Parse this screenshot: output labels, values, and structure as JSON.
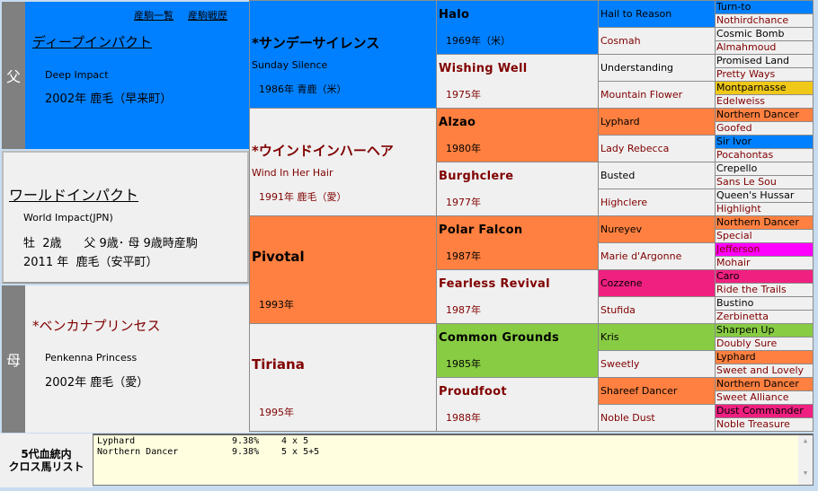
{
  "colors": {
    "blue": "#0080ff",
    "orange": "#ff8040",
    "pink": "#f02080",
    "magenta": "#ff00ff",
    "green": "#88cc44",
    "yellow": "#f0c818",
    "gray": "#f0f0f0"
  },
  "sire": {
    "strip": "父",
    "links": [
      "産駒一覧",
      "産駒戦歴"
    ],
    "name": "ディープインパクト",
    "en": "Deep Impact",
    "info": "2002年  鹿毛（早来町）"
  },
  "subject": {
    "name": "ワールドインパクト",
    "en": "World Impact(JPN)",
    "line1": "牡  2歳      父 9歳･ 母 9歳時産駒",
    "line2": "2011 年  鹿毛（安平町）"
  },
  "dam": {
    "strip": "母",
    "name": "*ベンカナプリンセス",
    "en": "Penkenna Princess",
    "info": "2002年  鹿毛（愛）"
  },
  "gen2": [
    {
      "name": "*サンデーサイレンス",
      "en": "Sunday Silence",
      "year": "1986年  青鹿（米）",
      "sex": "m",
      "bg": "blue"
    },
    {
      "name": "*ウインドインハーヘア",
      "en": "Wind In Her Hair",
      "year": "1991年  鹿毛（愛）",
      "sex": "f",
      "bg": "gray"
    },
    {
      "name": "Pivotal",
      "en": "",
      "year": "1993年",
      "sex": "m",
      "bg": "orange"
    },
    {
      "name": "Tiriana",
      "en": "",
      "year": "1995年",
      "sex": "f",
      "bg": "gray"
    }
  ],
  "gen3": [
    {
      "name": "Halo",
      "year": "1969年（米）",
      "sex": "m",
      "bg": "blue"
    },
    {
      "name": "Wishing Well",
      "year": "1975年",
      "sex": "f",
      "bg": "gray"
    },
    {
      "name": "Alzao",
      "year": "1980年",
      "sex": "m",
      "bg": "orange"
    },
    {
      "name": "Burghclere",
      "year": "1977年",
      "sex": "f",
      "bg": "gray"
    },
    {
      "name": "Polar Falcon",
      "year": "1987年",
      "sex": "m",
      "bg": "orange"
    },
    {
      "name": "Fearless Revival",
      "year": "1987年",
      "sex": "f",
      "bg": "gray"
    },
    {
      "name": "Common Grounds",
      "year": "1985年",
      "sex": "m",
      "bg": "green"
    },
    {
      "name": "Proudfoot",
      "year": "1988年",
      "sex": "f",
      "bg": "gray"
    }
  ],
  "gen4": [
    {
      "name": "Hail to Reason",
      "sex": "m",
      "bg": "blue"
    },
    {
      "name": "Cosmah",
      "sex": "f",
      "bg": "gray"
    },
    {
      "name": "Understanding",
      "sex": "m",
      "bg": "gray"
    },
    {
      "name": "Mountain Flower",
      "sex": "f",
      "bg": "gray"
    },
    {
      "name": "Lyphard",
      "sex": "m",
      "bg": "orange"
    },
    {
      "name": "Lady Rebecca",
      "sex": "f",
      "bg": "gray"
    },
    {
      "name": "Busted",
      "sex": "m",
      "bg": "gray"
    },
    {
      "name": "Highclere",
      "sex": "f",
      "bg": "gray"
    },
    {
      "name": "Nureyev",
      "sex": "m",
      "bg": "orange"
    },
    {
      "name": "Marie d'Argonne",
      "sex": "f",
      "bg": "gray"
    },
    {
      "name": "Cozzene",
      "sex": "m",
      "bg": "pink"
    },
    {
      "name": "Stufida",
      "sex": "f",
      "bg": "gray"
    },
    {
      "name": "Kris",
      "sex": "m",
      "bg": "green"
    },
    {
      "name": "Sweetly",
      "sex": "f",
      "bg": "gray"
    },
    {
      "name": "Shareef Dancer",
      "sex": "m",
      "bg": "orange"
    },
    {
      "name": "Noble Dust",
      "sex": "f",
      "bg": "gray"
    }
  ],
  "gen5": [
    {
      "name": "Turn-to",
      "sex": "m",
      "bg": "blue"
    },
    {
      "name": "Nothirdchance",
      "sex": "f",
      "bg": "gray"
    },
    {
      "name": "Cosmic Bomb",
      "sex": "m",
      "bg": "gray"
    },
    {
      "name": "Almahmoud",
      "sex": "f",
      "bg": "gray"
    },
    {
      "name": "Promised Land",
      "sex": "m",
      "bg": "gray"
    },
    {
      "name": "Pretty Ways",
      "sex": "f",
      "bg": "gray"
    },
    {
      "name": "Montparnasse",
      "sex": "m",
      "bg": "yellow"
    },
    {
      "name": "Edelweiss",
      "sex": "f",
      "bg": "gray"
    },
    {
      "name": "Northern Dancer",
      "sex": "m",
      "bg": "orange"
    },
    {
      "name": "Goofed",
      "sex": "f",
      "bg": "gray"
    },
    {
      "name": "Sir Ivor",
      "sex": "m",
      "bg": "blue"
    },
    {
      "name": "Pocahontas",
      "sex": "f",
      "bg": "gray"
    },
    {
      "name": "Crepello",
      "sex": "m",
      "bg": "gray"
    },
    {
      "name": "Sans Le Sou",
      "sex": "f",
      "bg": "gray"
    },
    {
      "name": "Queen's Hussar",
      "sex": "m",
      "bg": "gray"
    },
    {
      "name": "Highlight",
      "sex": "f",
      "bg": "gray"
    },
    {
      "name": "Northern Dancer",
      "sex": "m",
      "bg": "orange"
    },
    {
      "name": "Special",
      "sex": "f",
      "bg": "gray"
    },
    {
      "name": "Jefferson",
      "sex": "f",
      "bg": "magenta"
    },
    {
      "name": "Mohair",
      "sex": "f",
      "bg": "gray"
    },
    {
      "name": "Caro",
      "sex": "m",
      "bg": "pink"
    },
    {
      "name": "Ride the Trails",
      "sex": "f",
      "bg": "gray"
    },
    {
      "name": "Bustino",
      "sex": "m",
      "bg": "gray"
    },
    {
      "name": "Zerbinetta",
      "sex": "f",
      "bg": "gray"
    },
    {
      "name": "Sharpen Up",
      "sex": "m",
      "bg": "green"
    },
    {
      "name": "Doubly Sure",
      "sex": "f",
      "bg": "gray"
    },
    {
      "name": "Lyphard",
      "sex": "m",
      "bg": "orange"
    },
    {
      "name": "Sweet and Lovely",
      "sex": "f",
      "bg": "gray"
    },
    {
      "name": "Northern Dancer",
      "sex": "m",
      "bg": "orange"
    },
    {
      "name": "Sweet Alliance",
      "sex": "f",
      "bg": "gray"
    },
    {
      "name": "Dust Commander",
      "sex": "m",
      "bg": "pink"
    },
    {
      "name": "Noble Treasure",
      "sex": "f",
      "bg": "gray"
    }
  ],
  "cross": {
    "label": "5代血統内\nクロス馬リスト",
    "rows": [
      {
        "name": "Lyphard",
        "pct": "9.38%",
        "pattern": "4 x 5"
      },
      {
        "name": "Northern Dancer",
        "pct": "9.38%",
        "pattern": "5 x 5+5"
      }
    ]
  }
}
